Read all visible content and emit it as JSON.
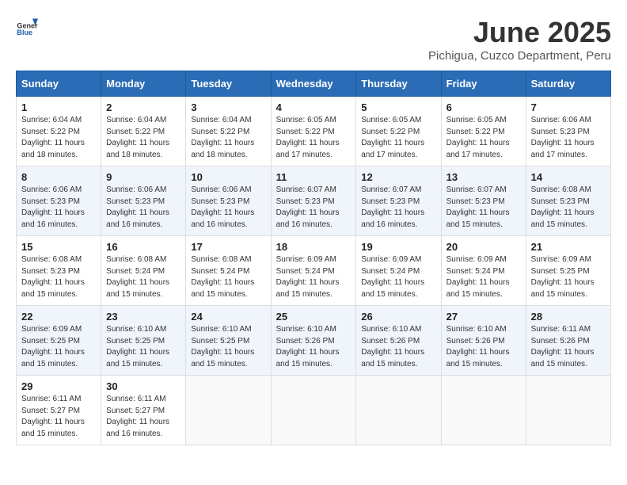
{
  "header": {
    "logo_general": "General",
    "logo_blue": "Blue",
    "month_year": "June 2025",
    "location": "Pichigua, Cuzco Department, Peru"
  },
  "weekdays": [
    "Sunday",
    "Monday",
    "Tuesday",
    "Wednesday",
    "Thursday",
    "Friday",
    "Saturday"
  ],
  "weeks": [
    [
      {
        "day": "1",
        "sunrise": "6:04 AM",
        "sunset": "5:22 PM",
        "daylight": "11 hours and 18 minutes."
      },
      {
        "day": "2",
        "sunrise": "6:04 AM",
        "sunset": "5:22 PM",
        "daylight": "11 hours and 18 minutes."
      },
      {
        "day": "3",
        "sunrise": "6:04 AM",
        "sunset": "5:22 PM",
        "daylight": "11 hours and 18 minutes."
      },
      {
        "day": "4",
        "sunrise": "6:05 AM",
        "sunset": "5:22 PM",
        "daylight": "11 hours and 17 minutes."
      },
      {
        "day": "5",
        "sunrise": "6:05 AM",
        "sunset": "5:22 PM",
        "daylight": "11 hours and 17 minutes."
      },
      {
        "day": "6",
        "sunrise": "6:05 AM",
        "sunset": "5:22 PM",
        "daylight": "11 hours and 17 minutes."
      },
      {
        "day": "7",
        "sunrise": "6:06 AM",
        "sunset": "5:23 PM",
        "daylight": "11 hours and 17 minutes."
      }
    ],
    [
      {
        "day": "8",
        "sunrise": "6:06 AM",
        "sunset": "5:23 PM",
        "daylight": "11 hours and 16 minutes."
      },
      {
        "day": "9",
        "sunrise": "6:06 AM",
        "sunset": "5:23 PM",
        "daylight": "11 hours and 16 minutes."
      },
      {
        "day": "10",
        "sunrise": "6:06 AM",
        "sunset": "5:23 PM",
        "daylight": "11 hours and 16 minutes."
      },
      {
        "day": "11",
        "sunrise": "6:07 AM",
        "sunset": "5:23 PM",
        "daylight": "11 hours and 16 minutes."
      },
      {
        "day": "12",
        "sunrise": "6:07 AM",
        "sunset": "5:23 PM",
        "daylight": "11 hours and 16 minutes."
      },
      {
        "day": "13",
        "sunrise": "6:07 AM",
        "sunset": "5:23 PM",
        "daylight": "11 hours and 15 minutes."
      },
      {
        "day": "14",
        "sunrise": "6:08 AM",
        "sunset": "5:23 PM",
        "daylight": "11 hours and 15 minutes."
      }
    ],
    [
      {
        "day": "15",
        "sunrise": "6:08 AM",
        "sunset": "5:23 PM",
        "daylight": "11 hours and 15 minutes."
      },
      {
        "day": "16",
        "sunrise": "6:08 AM",
        "sunset": "5:24 PM",
        "daylight": "11 hours and 15 minutes."
      },
      {
        "day": "17",
        "sunrise": "6:08 AM",
        "sunset": "5:24 PM",
        "daylight": "11 hours and 15 minutes."
      },
      {
        "day": "18",
        "sunrise": "6:09 AM",
        "sunset": "5:24 PM",
        "daylight": "11 hours and 15 minutes."
      },
      {
        "day": "19",
        "sunrise": "6:09 AM",
        "sunset": "5:24 PM",
        "daylight": "11 hours and 15 minutes."
      },
      {
        "day": "20",
        "sunrise": "6:09 AM",
        "sunset": "5:24 PM",
        "daylight": "11 hours and 15 minutes."
      },
      {
        "day": "21",
        "sunrise": "6:09 AM",
        "sunset": "5:25 PM",
        "daylight": "11 hours and 15 minutes."
      }
    ],
    [
      {
        "day": "22",
        "sunrise": "6:09 AM",
        "sunset": "5:25 PM",
        "daylight": "11 hours and 15 minutes."
      },
      {
        "day": "23",
        "sunrise": "6:10 AM",
        "sunset": "5:25 PM",
        "daylight": "11 hours and 15 minutes."
      },
      {
        "day": "24",
        "sunrise": "6:10 AM",
        "sunset": "5:25 PM",
        "daylight": "11 hours and 15 minutes."
      },
      {
        "day": "25",
        "sunrise": "6:10 AM",
        "sunset": "5:26 PM",
        "daylight": "11 hours and 15 minutes."
      },
      {
        "day": "26",
        "sunrise": "6:10 AM",
        "sunset": "5:26 PM",
        "daylight": "11 hours and 15 minutes."
      },
      {
        "day": "27",
        "sunrise": "6:10 AM",
        "sunset": "5:26 PM",
        "daylight": "11 hours and 15 minutes."
      },
      {
        "day": "28",
        "sunrise": "6:11 AM",
        "sunset": "5:26 PM",
        "daylight": "11 hours and 15 minutes."
      }
    ],
    [
      {
        "day": "29",
        "sunrise": "6:11 AM",
        "sunset": "5:27 PM",
        "daylight": "11 hours and 15 minutes."
      },
      {
        "day": "30",
        "sunrise": "6:11 AM",
        "sunset": "5:27 PM",
        "daylight": "11 hours and 16 minutes."
      },
      null,
      null,
      null,
      null,
      null
    ]
  ]
}
